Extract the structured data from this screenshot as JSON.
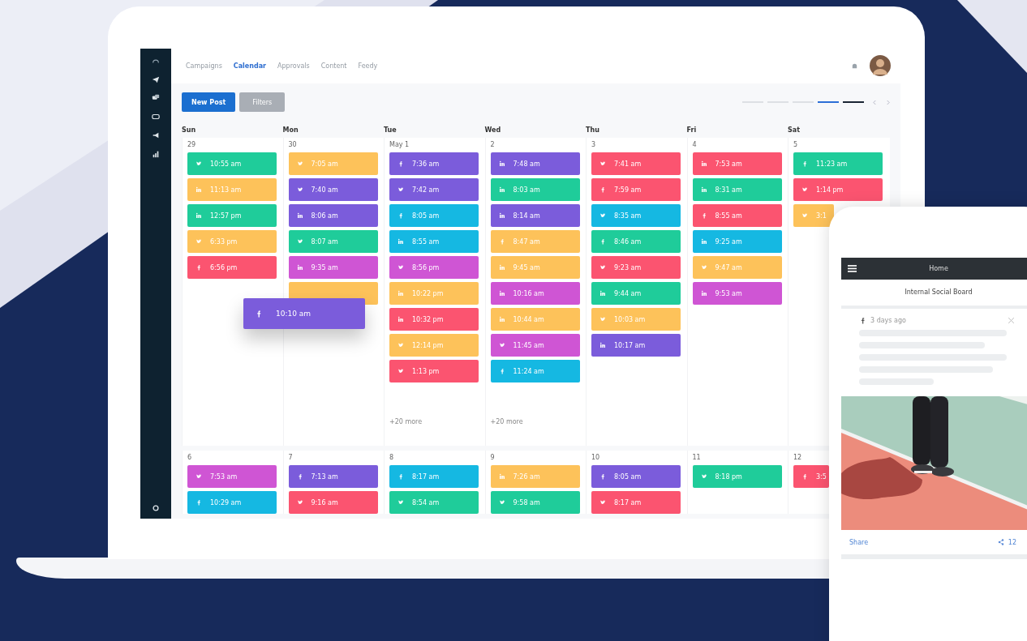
{
  "nav": {
    "tabs": [
      {
        "label": "Campaigns",
        "selected": false
      },
      {
        "label": "Calendar",
        "selected": true
      },
      {
        "label": "Approvals",
        "selected": false
      },
      {
        "label": "Content",
        "selected": false
      },
      {
        "label": "Feedy",
        "selected": false
      }
    ]
  },
  "toolbar": {
    "new_post": "New Post",
    "filters": "Filters",
    "views": [
      {
        "selected": false
      },
      {
        "selected": false
      },
      {
        "selected": false
      },
      {
        "selected": true
      },
      {
        "selected": false
      }
    ]
  },
  "days": [
    "Sun",
    "Mon",
    "Tue",
    "Wed",
    "Thu",
    "Fri",
    "Sat"
  ],
  "weeks": [
    {
      "cells": [
        {
          "date": "29",
          "posts": [
            {
              "kind": "twitter",
              "time": "10:55 am",
              "color": "#1fcc9a"
            },
            {
              "kind": "linkedin",
              "time": "11:13 am",
              "color": "#fdc25a"
            },
            {
              "kind": "linkedin",
              "time": "12:57 pm",
              "color": "#1fcc9a"
            },
            {
              "kind": "twitter",
              "time": "6:33 pm",
              "color": "#fdc25a"
            },
            {
              "kind": "facebook",
              "time": "6:56 pm",
              "color": "#fb5470"
            }
          ]
        },
        {
          "date": "30",
          "posts": [
            {
              "kind": "twitter",
              "time": "7:05 am",
              "color": "#fdc25a"
            },
            {
              "kind": "twitter",
              "time": "7:40 am",
              "color": "#7b5cdb"
            },
            {
              "kind": "linkedin",
              "time": "8:06 am",
              "color": "#7b5cdb"
            },
            {
              "kind": "twitter",
              "time": "8:07 am",
              "color": "#1fcc9a"
            },
            {
              "kind": "linkedin",
              "time": "9:35 am",
              "color": "#cf55d4"
            },
            {
              "color": "#fdc25a"
            }
          ]
        },
        {
          "date": "May 1",
          "posts": [
            {
              "kind": "facebook",
              "time": "7:36 am",
              "color": "#7b5cdb"
            },
            {
              "kind": "twitter",
              "time": "7:42 am",
              "color": "#7b5cdb"
            },
            {
              "kind": "facebook",
              "time": "8:05 am",
              "color": "#15b8e2"
            },
            {
              "kind": "linkedin",
              "time": "8:55 am",
              "color": "#15b8e2"
            },
            {
              "kind": "twitter",
              "time": "8:56 pm",
              "color": "#cf55d4"
            },
            {
              "kind": "linkedin",
              "time": "10:22 pm",
              "color": "#fdc25a"
            },
            {
              "kind": "linkedin",
              "time": "10:32 pm",
              "color": "#fb5470"
            },
            {
              "kind": "twitter",
              "time": "12:14 pm",
              "color": "#fdc25a"
            },
            {
              "kind": "twitter",
              "time": "1:13 pm",
              "color": "#fb5470"
            }
          ],
          "more": "+20 more"
        },
        {
          "date": "2",
          "posts": [
            {
              "kind": "linkedin",
              "time": "7:48 am",
              "color": "#7b5cdb"
            },
            {
              "kind": "linkedin",
              "time": "8:03 am",
              "color": "#1fcc9a"
            },
            {
              "kind": "linkedin",
              "time": "8:14 am",
              "color": "#7b5cdb"
            },
            {
              "kind": "facebook",
              "time": "8:47 am",
              "color": "#fdc25a"
            },
            {
              "kind": "linkedin",
              "time": "9:45 am",
              "color": "#fdc25a"
            },
            {
              "kind": "linkedin",
              "time": "10:16 am",
              "color": "#cf55d4"
            },
            {
              "kind": "linkedin",
              "time": "10:44 am",
              "color": "#fdc25a"
            },
            {
              "kind": "twitter",
              "time": "11:45 am",
              "color": "#cf55d4"
            },
            {
              "kind": "facebook",
              "time": "11:24 am",
              "color": "#15b8e2"
            }
          ],
          "more": "+20 more"
        },
        {
          "date": "3",
          "posts": [
            {
              "kind": "twitter",
              "time": "7:41 am",
              "color": "#fb5470"
            },
            {
              "kind": "facebook",
              "time": "7:59 am",
              "color": "#fb5470"
            },
            {
              "kind": "twitter",
              "time": "8:35 am",
              "color": "#15b8e2"
            },
            {
              "kind": "facebook",
              "time": "8:46 am",
              "color": "#1fcc9a"
            },
            {
              "kind": "twitter",
              "time": "9:23 am",
              "color": "#fb5470"
            },
            {
              "kind": "linkedin",
              "time": "9:44 am",
              "color": "#1fcc9a"
            },
            {
              "kind": "twitter",
              "time": "10:03 am",
              "color": "#fdc25a"
            },
            {
              "kind": "linkedin",
              "time": "10:17 am",
              "color": "#7b5cdb"
            }
          ]
        },
        {
          "date": "4",
          "posts": [
            {
              "kind": "linkedin",
              "time": "7:53 am",
              "color": "#fb5470"
            },
            {
              "kind": "linkedin",
              "time": "8:31 am",
              "color": "#1fcc9a"
            },
            {
              "kind": "facebook",
              "time": "8:55 am",
              "color": "#fb5470"
            },
            {
              "kind": "linkedin",
              "time": "9:25 am",
              "color": "#15b8e2"
            },
            {
              "kind": "twitter",
              "time": "9:47 am",
              "color": "#fdc25a"
            },
            {
              "kind": "linkedin",
              "time": "9:53 am",
              "color": "#cf55d4"
            }
          ]
        },
        {
          "date": "5",
          "posts": [
            {
              "kind": "facebook",
              "time": "11:23 am",
              "color": "#1fcc9a"
            },
            {
              "kind": "twitter",
              "time": "1:14 pm",
              "color": "#fb5470"
            },
            {
              "kind": "twitter",
              "time": "3:1",
              "color": "#fdc25a"
            }
          ]
        }
      ]
    },
    {
      "cells": [
        {
          "date": "6",
          "posts": [
            {
              "kind": "twitter",
              "time": "7:53 am",
              "color": "#cf55d4"
            },
            {
              "kind": "facebook",
              "time": "10:29 am",
              "color": "#15b8e2"
            }
          ]
        },
        {
          "date": "7",
          "posts": [
            {
              "kind": "facebook",
              "time": "7:13 am",
              "color": "#7b5cdb"
            },
            {
              "kind": "twitter",
              "time": "9:16 am",
              "color": "#fb5470"
            }
          ]
        },
        {
          "date": "8",
          "posts": [
            {
              "kind": "facebook",
              "time": "8:17 am",
              "color": "#15b8e2"
            },
            {
              "kind": "twitter",
              "time": "8:54 am",
              "color": "#1fcc9a"
            }
          ]
        },
        {
          "date": "9",
          "posts": [
            {
              "kind": "linkedin",
              "time": "7:26 am",
              "color": "#fdc25a"
            },
            {
              "kind": "twitter",
              "time": "9:58 am",
              "color": "#1fcc9a"
            }
          ]
        },
        {
          "date": "10",
          "posts": [
            {
              "kind": "facebook",
              "time": "8:05 am",
              "color": "#7b5cdb"
            },
            {
              "kind": "twitter",
              "time": "8:17 am",
              "color": "#fb5470"
            }
          ]
        },
        {
          "date": "11",
          "posts": [
            {
              "kind": "twitter",
              "time": "8:18 pm",
              "color": "#1fcc9a"
            }
          ]
        },
        {
          "date": "12",
          "posts": [
            {
              "kind": "facebook",
              "time": "3:5",
              "color": "#fb5470"
            }
          ]
        }
      ]
    }
  ],
  "dragged_post": {
    "kind": "facebook",
    "time": "10:10 am",
    "color": "#7b5cdb"
  },
  "phone": {
    "title": "Home",
    "board": "Internal Social Board",
    "post": {
      "kind": "facebook",
      "age": "3 days ago",
      "share": "Share",
      "share_count": "12"
    }
  }
}
